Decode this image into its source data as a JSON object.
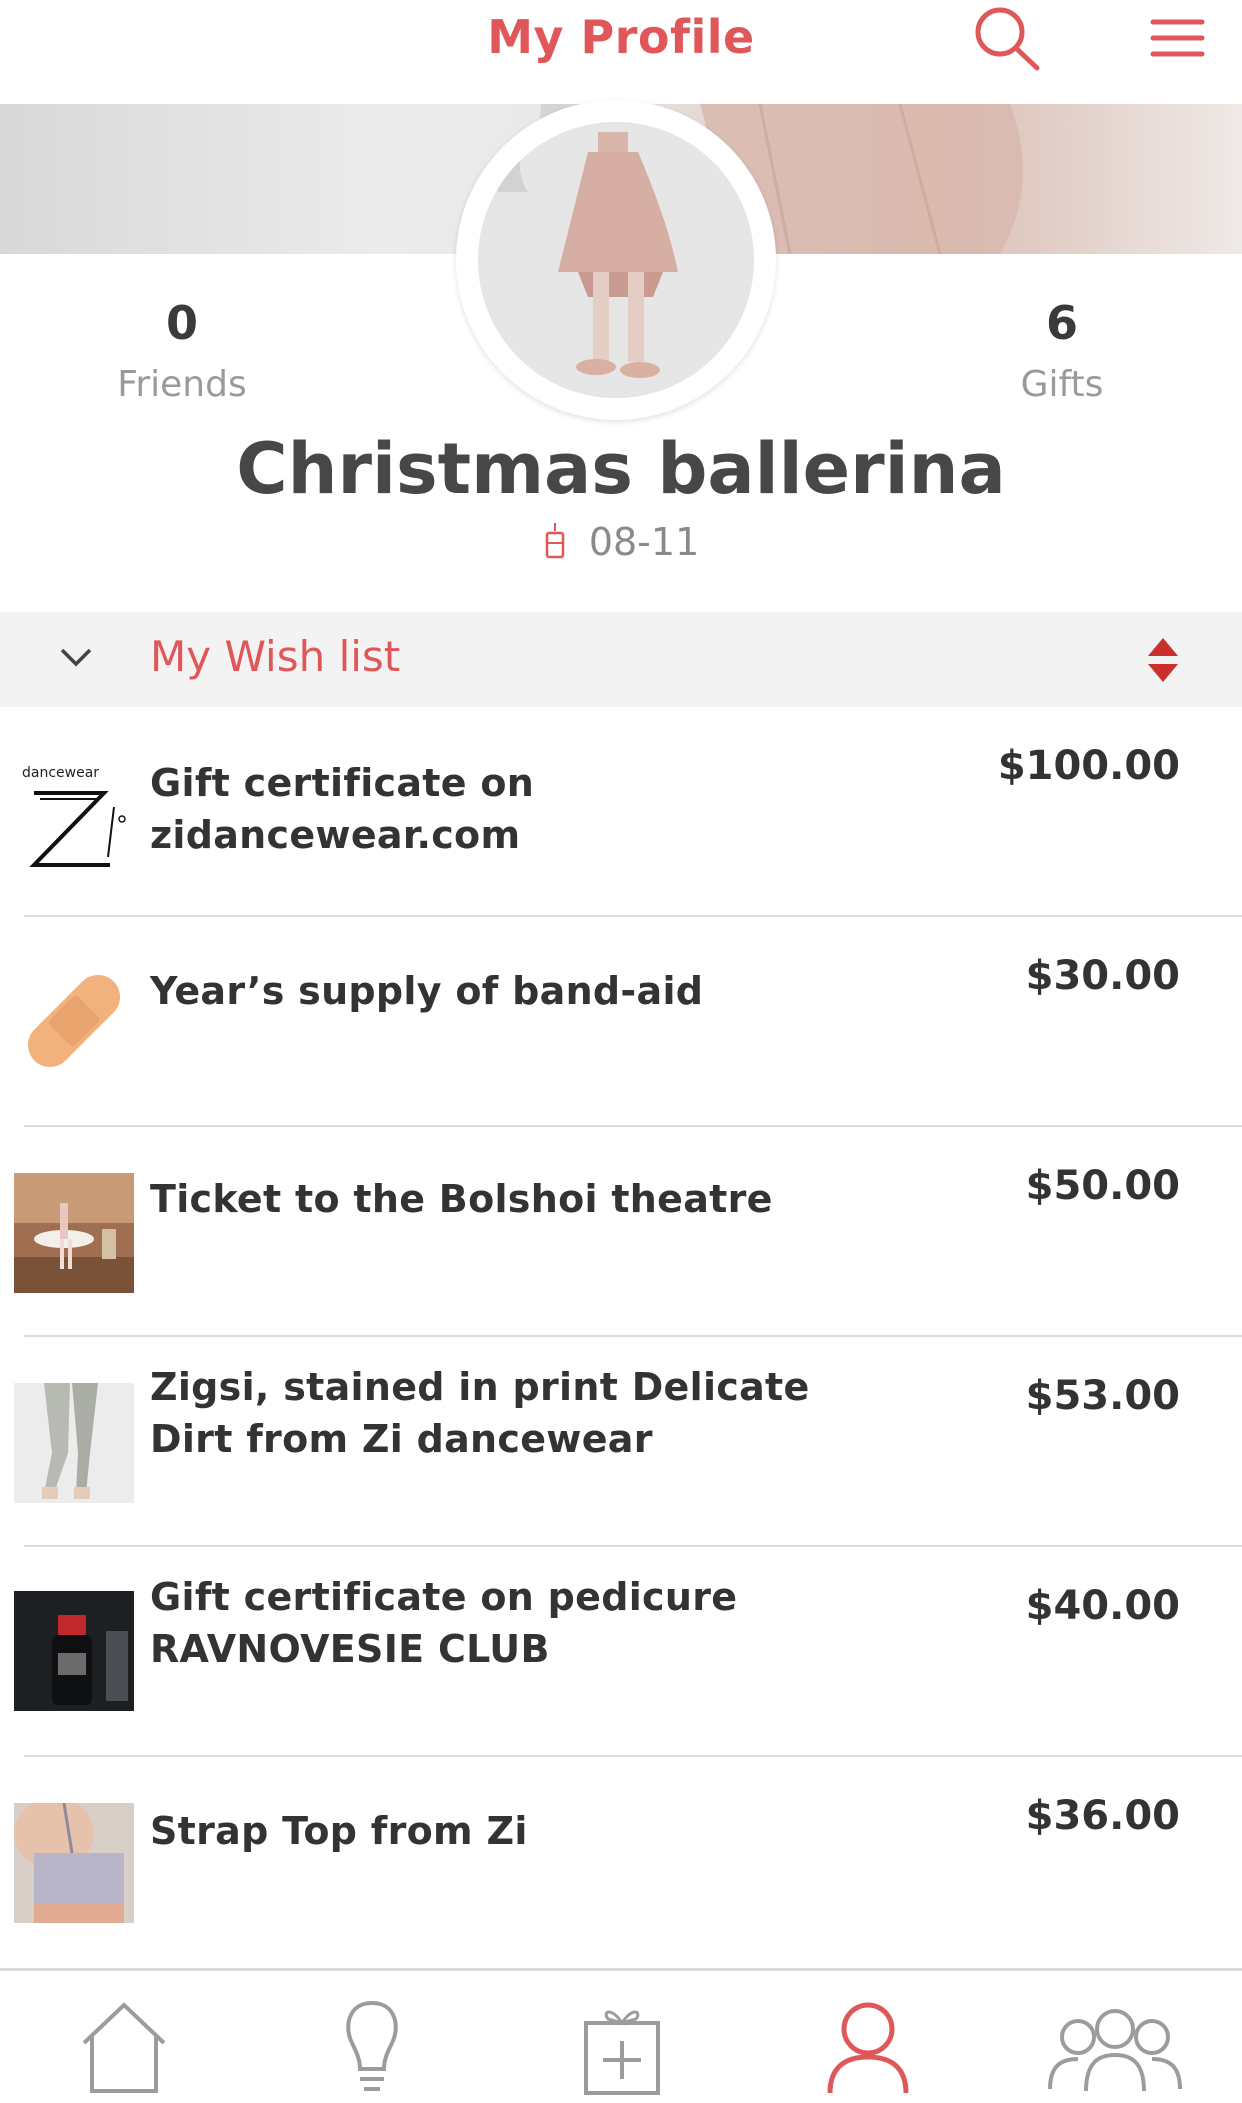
{
  "header": {
    "title": "My Profile"
  },
  "profile": {
    "name": "Christmas ballerina",
    "birthday": "08-11",
    "friends_count": "0",
    "friends_label": "Friends",
    "gifts_count": "6",
    "gifts_label": "Gifts"
  },
  "wishlist": {
    "label": "My Wish list",
    "items": [
      {
        "title": "Gift certificate on zidancewear.com",
        "price": "$100.00",
        "logo_text": "dancewear"
      },
      {
        "title": "Year’s supply of band-aid",
        "price": "$30.00"
      },
      {
        "title": "Ticket to the Bolshoi theatre",
        "price": "$50.00"
      },
      {
        "title": "Zigsi, stained in print Delicate Dirt from Zi dancewear",
        "price": "$53.00"
      },
      {
        "title": "Gift certificate on pedicure RAVNOVESIE CLUB",
        "price": "$40.00"
      },
      {
        "title": "Strap Top from Zi",
        "price": "$36.00"
      }
    ]
  },
  "nav": {
    "tabs": [
      "home-icon",
      "lightbulb-icon",
      "gift-icon",
      "profile-icon",
      "groups-icon"
    ],
    "active": "profile-icon"
  },
  "colors": {
    "accent": "#e0575a",
    "text": "#3a3a3a",
    "muted": "#9a9a9a"
  }
}
